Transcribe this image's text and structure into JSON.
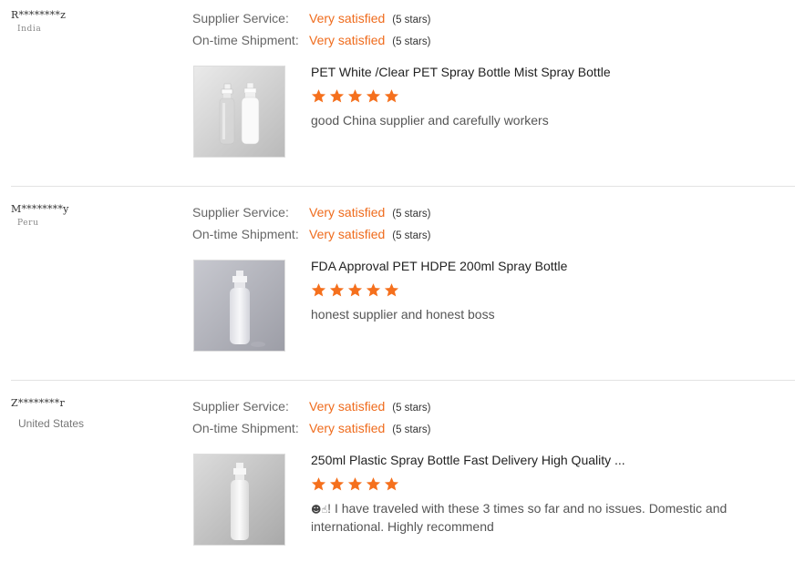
{
  "reviews": [
    {
      "buyer": "R********z",
      "country": "India",
      "ratings": [
        {
          "label": "Supplier Service:",
          "value": "Very satisfied",
          "stars": "(5 stars)"
        },
        {
          "label": "On-time Shipment:",
          "value": "Very satisfied",
          "stars": "(5 stars)"
        }
      ],
      "product": "PET White /Clear PET Spray Bottle Mist Spray Bottle",
      "star_rating": 5,
      "comment": "good China supplier and carefully workers"
    },
    {
      "buyer": "M********y",
      "country": "Peru",
      "ratings": [
        {
          "label": "Supplier Service:",
          "value": "Very satisfied",
          "stars": "(5 stars)"
        },
        {
          "label": "On-time Shipment:",
          "value": "Very satisfied",
          "stars": "(5 stars)"
        }
      ],
      "product": "FDA Approval PET HDPE 200ml Spray Bottle",
      "star_rating": 5,
      "comment": "honest supplier and honest boss"
    },
    {
      "buyer": "Z********r",
      "country": "United States",
      "ratings": [
        {
          "label": "Supplier Service:",
          "value": "Very satisfied",
          "stars": "(5 stars)"
        },
        {
          "label": "On-time Shipment:",
          "value": "Very satisfied",
          "stars": "(5 stars)"
        }
      ],
      "product": "250ml Plastic Spray Bottle Fast Delivery High Quality ...",
      "star_rating": 5,
      "comment_icons": "☻☝",
      "comment": "! I have traveled with these 3 times so far and no issues. Domestic and international. Highly recommend"
    }
  ],
  "colors": {
    "accent": "#ef6b1c",
    "star": "#f5701d",
    "divider": "#e3e3e3"
  }
}
